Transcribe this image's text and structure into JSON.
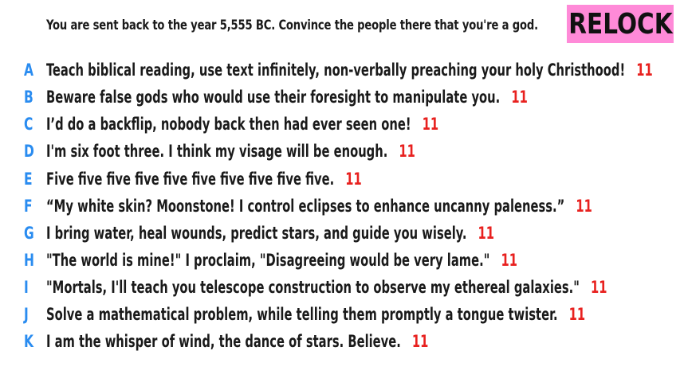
{
  "prompt": "You are sent back to the year 5,555 BC. Convince the people there that you're a god.",
  "badge": "RELOCK",
  "colors": {
    "letter": "#2a8cf0",
    "score": "#e8211f",
    "badge_bg": "#ff8ad8"
  },
  "answers": [
    {
      "letter": "A",
      "text": "Teach biblical reading, use text infinitely, non-verbally preaching your holy Christhood!",
      "score": "11"
    },
    {
      "letter": "B",
      "text": "Beware false gods who would use their foresight to manipulate you.",
      "score": "11"
    },
    {
      "letter": "C",
      "text": "I’d do a backflip, nobody back then had ever seen one!",
      "score": "11"
    },
    {
      "letter": "D",
      "text": "I'm six foot three. I think my visage will be enough.",
      "score": "11"
    },
    {
      "letter": "E",
      "text": "Five five five five five five five five five five.",
      "score": "11"
    },
    {
      "letter": "F",
      "text": "“My white skin? Moonstone! I control eclipses to enhance uncanny paleness.”",
      "score": "11"
    },
    {
      "letter": "G",
      "text": "I bring water, heal wounds, predict stars, and guide you wisely.",
      "score": "11"
    },
    {
      "letter": "H",
      "text": "\"The world is mine!\" I proclaim, \"Disagreeing would be very lame.\"",
      "score": "11"
    },
    {
      "letter": "I",
      "text": "\"Mortals, I'll teach you telescope construction to observe my ethereal galaxies.\"",
      "score": "11"
    },
    {
      "letter": "J",
      "text": "Solve a mathematical problem, while telling them promptly a tongue twister.",
      "score": "11"
    },
    {
      "letter": "K",
      "text": "I am the whisper of wind, the dance of stars. Believe.",
      "score": "11"
    }
  ]
}
